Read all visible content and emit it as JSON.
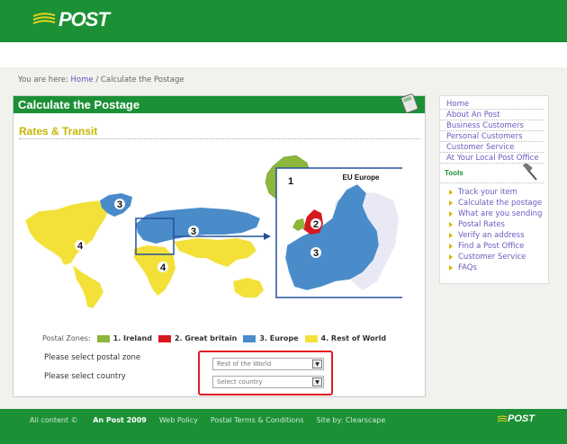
{
  "header": {
    "logo_text": "POST"
  },
  "breadcrumb": {
    "prefix": "You are here:",
    "home": "Home",
    "separator": "/",
    "current": "Calculate the Postage"
  },
  "main": {
    "title": "Calculate the Postage",
    "subtitle": "Rates & Transit",
    "map": {
      "inset_title": "EU Europe",
      "zone_numbers": [
        "1",
        "2",
        "3",
        "3",
        "3",
        "4",
        "4"
      ]
    },
    "legend": {
      "label": "Postal Zones:",
      "zones": [
        {
          "label": "1. Ireland",
          "color": "#8cb63c"
        },
        {
          "label": "2. Great britain",
          "color": "#d7181f"
        },
        {
          "label": "3. Europe",
          "color": "#4a8cc9"
        },
        {
          "label": "4. Rest of World",
          "color": "#f3e13a"
        }
      ]
    },
    "form": {
      "zone_label": "Please select postal zone",
      "zone_value": "Rest of the World",
      "country_label": "Please select country",
      "country_value": "Select country"
    }
  },
  "sidebar": {
    "nav": [
      "Home",
      "About An Post",
      "Business Customers",
      "Personal Customers",
      "Customer Service",
      "At Your Local Post Office"
    ],
    "tools_title": "Tools",
    "tools": [
      "Track your item",
      "Calculate the postage",
      "What are you sending",
      "Postal Rates",
      "Verify an address",
      "Find a Post Office",
      "Customer Service",
      "FAQs"
    ]
  },
  "footer": {
    "copyright_prefix": "All content ©",
    "copyright_owner": "An Post 2009",
    "links": [
      "Web Policy",
      "Postal Terms & Conditions",
      "Site by: Clearscape"
    ],
    "logo_text": "POST"
  }
}
